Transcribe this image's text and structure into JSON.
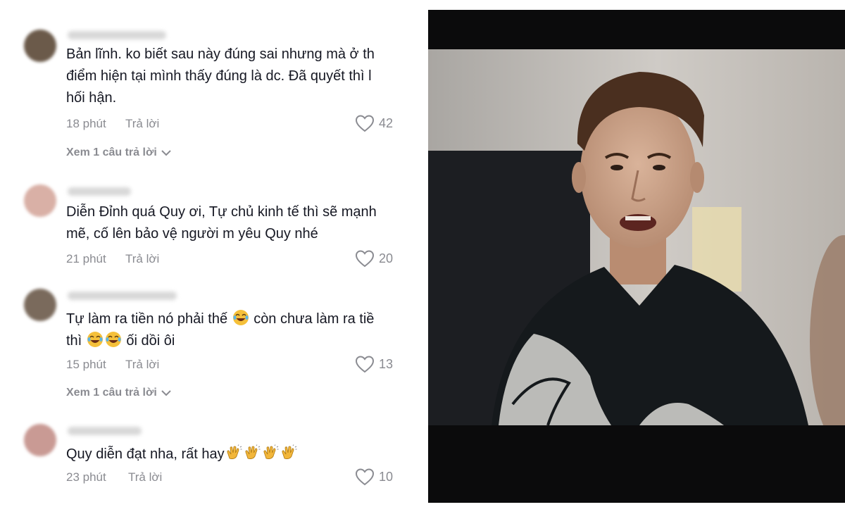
{
  "comments": [
    {
      "text_lines": [
        "Bản lĩnh. ko biết sau này đúng sai nhưng mà ở th",
        "điểm hiện tại mình thấy đúng là dc. Đã quyết thì l",
        "hối hận."
      ],
      "time": "18 phút",
      "reply_label": "Trả lời",
      "likes": "42",
      "view_replies": "Xem 1 câu trả lời",
      "avatar_color": "#6b5a4a"
    },
    {
      "text_lines": [
        "Diễn Đỉnh quá Quy ơi, Tự chủ kinh tế thì sẽ mạnh",
        "mẽ, cố lên bảo vệ người m yêu Quy nhé"
      ],
      "time": "21 phút",
      "reply_label": "Trả lời",
      "likes": "20",
      "avatar_color": "#d9b0a6"
    },
    {
      "text_lines": [
        "Tự làm ra tiền nó phải thế",
        "còn chưa làm ra tiề",
        "thì",
        "ối dồi ôi"
      ],
      "time": "15 phút",
      "reply_label": "Trả lời",
      "likes": "13",
      "view_replies": "Xem 1 câu trả lời",
      "avatar_color": "#7a6a5c"
    },
    {
      "text_lines": [
        "Quy diễn đạt nha, rất hay"
      ],
      "time": "23 phút",
      "reply_label": "Trả lời",
      "likes": "10",
      "avatar_color": "#c99a94"
    }
  ],
  "icons": {
    "like": "heart-outline-icon",
    "expand": "chevron-down-icon",
    "laugh": "tears-of-joy-emoji",
    "clap": "clapping-hands-emoji"
  },
  "colors": {
    "text": "#161823",
    "meta": "#8a8b91",
    "tv_bezel": "#0b0b0c"
  }
}
